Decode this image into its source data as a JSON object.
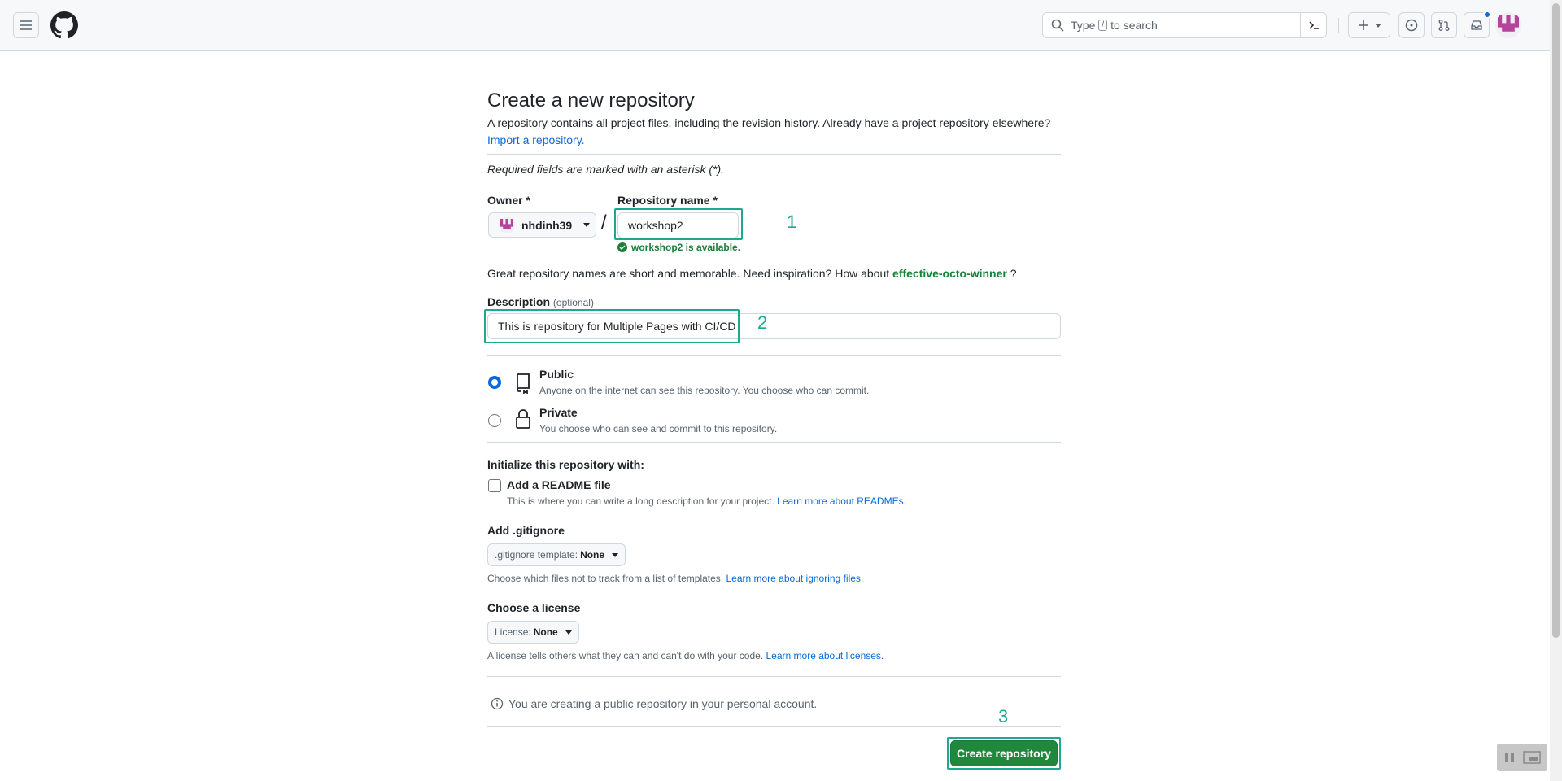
{
  "header": {
    "search_prefix": "Type",
    "search_key": "/",
    "search_suffix": "to search"
  },
  "page": {
    "title": "Create a new repository",
    "subtitle": "A repository contains all project files, including the revision history. Already have a project repository elsewhere?",
    "import_link": "Import a repository.",
    "required_note": "Required fields are marked with an asterisk (*).",
    "owner_label": "Owner *",
    "owner_value": "nhdinh39",
    "slash": "/",
    "repo_label": "Repository name *",
    "repo_value": "workshop2",
    "availability": "workshop2 is available.",
    "great_names_prefix": "Great repository names are short and memorable. Need inspiration? How about",
    "suggested_name": "effective-octo-winner",
    "great_names_suffix": "?",
    "description_label": "Description",
    "description_optional": "(optional)",
    "description_value": "This is repository for Multiple Pages with CI/CD",
    "visibility": [
      {
        "title": "Public",
        "desc": "Anyone on the internet can see this repository. You choose who can commit.",
        "checked": true
      },
      {
        "title": "Private",
        "desc": "You choose who can see and commit to this repository.",
        "checked": false
      }
    ],
    "init_label": "Initialize this repository with:",
    "readme_label": "Add a README file",
    "readme_desc": "This is where you can write a long description for your project.",
    "readme_link": "Learn more about READMEs.",
    "gitignore_label": "Add .gitignore",
    "gitignore_prefix": ".gitignore template:",
    "gitignore_value": "None",
    "gitignore_desc": "Choose which files not to track from a list of templates.",
    "gitignore_link": "Learn more about ignoring files.",
    "license_label": "Choose a license",
    "license_prefix": "License:",
    "license_value": "None",
    "license_desc": "A license tells others what they can and can't do with your code.",
    "license_link": "Learn more about licenses.",
    "info_text": "You are creating a public repository in your personal account.",
    "create_button": "Create repository"
  },
  "annotations": {
    "one": "1",
    "two": "2",
    "three": "3",
    "color": "#1fa890"
  },
  "colors": {
    "accent_blue": "#0969da",
    "success_green": "#1a7f37",
    "button_green": "#1f883d"
  }
}
